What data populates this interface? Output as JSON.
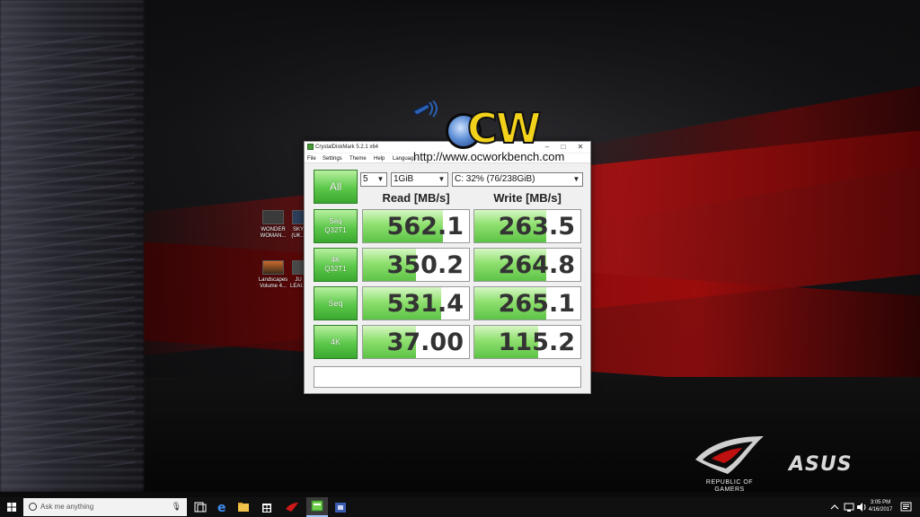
{
  "desktop": {
    "icons": [
      {
        "label": "WONDER WOMAN..."
      },
      {
        "label": "SKY (UK..."
      },
      {
        "label": "Landscapes Volume 4..."
      },
      {
        "label": "JU LEAI..."
      }
    ]
  },
  "watermark": {
    "url": "http://www.ocworkbench.com"
  },
  "window": {
    "title": "CrystalDiskMark 5.2.1 x64",
    "minimize": "–",
    "maximize": "□",
    "close": "✕",
    "menu": [
      "File",
      "Settings",
      "Theme",
      "Help",
      "Language"
    ],
    "all_button": "All",
    "count_select": "5",
    "size_select": "1GiB",
    "drive_select": "C: 32% (76/238GiB)",
    "read_header": "Read [MB/s]",
    "write_header": "Write [MB/s]",
    "rows": [
      {
        "label_line1": "Seq",
        "label_line2": "Q32T1",
        "read": "562.1",
        "write": "263.5",
        "read_fill": 0.75,
        "write_fill": 0.68
      },
      {
        "label_line1": "4K",
        "label_line2": "Q32T1",
        "read": "350.2",
        "write": "264.8",
        "read_fill": 0.5,
        "write_fill": 0.68
      },
      {
        "label_line1": "Seq",
        "label_line2": "",
        "read": "531.4",
        "write": "265.1",
        "read_fill": 0.74,
        "write_fill": 0.68
      },
      {
        "label_line1": "4K",
        "label_line2": "",
        "read": "37.00",
        "write": "115.2",
        "read_fill": 0.5,
        "write_fill": 0.6
      }
    ],
    "comment": ""
  },
  "branding": {
    "rog_text": "REPUBLIC OF GAMERS",
    "asus_text": "ASUS"
  },
  "taskbar": {
    "search_placeholder": "Ask me anything",
    "clock_time": "3:05 PM",
    "clock_date": "4/16/2017"
  },
  "colors": {
    "accent_green": "#5cc84a",
    "bar_fill": "#8fe06f",
    "wallpaper_red": "#b01010"
  }
}
